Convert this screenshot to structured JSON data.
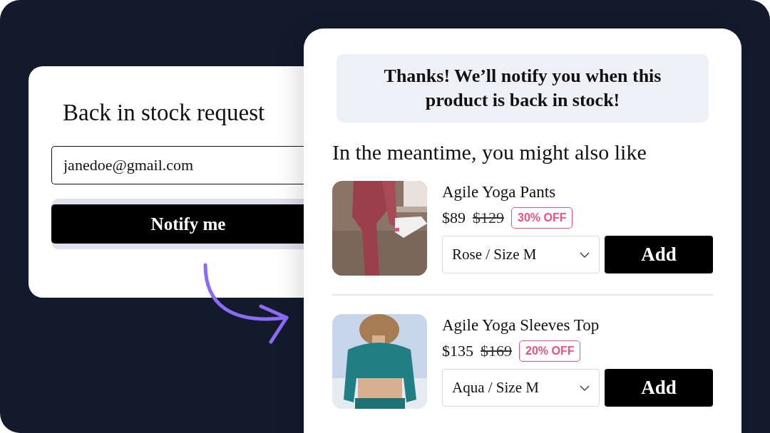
{
  "request_card": {
    "title": "Back in stock request",
    "email": "janedoe@gmail.com",
    "button": "Notify me"
  },
  "confirmation": {
    "message": "Thanks! We’ll notify you when this product is back in stock!",
    "heading": "In the meantime, you might also like",
    "products": [
      {
        "name": "Agile Yoga Pants",
        "price": "$89",
        "original_price": "$129",
        "discount": "30% OFF",
        "variant": "Rose / Size M",
        "button": "Add"
      },
      {
        "name": "Agile Yoga Sleeves Top",
        "price": "$135",
        "original_price": "$169",
        "discount": "20% OFF",
        "variant": "Aqua / Size M",
        "button": "Add"
      }
    ]
  }
}
